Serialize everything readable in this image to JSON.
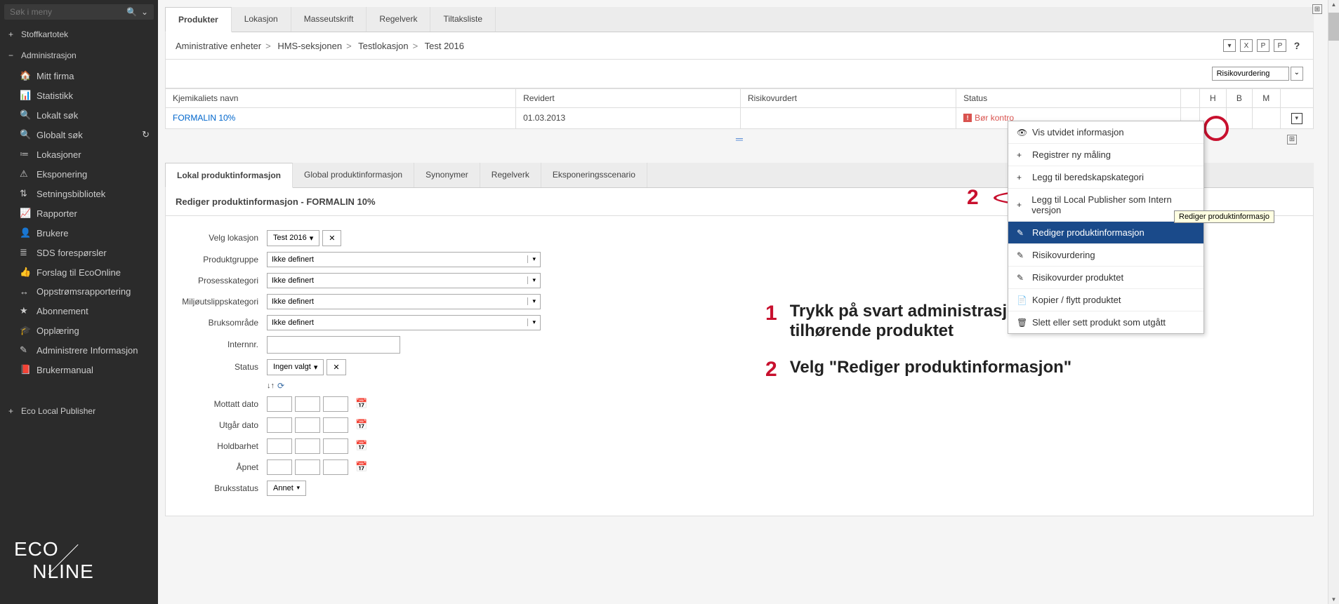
{
  "sidebar": {
    "search_placeholder": "Søk i meny",
    "sections": [
      {
        "toggle": "+",
        "label": "Stoffkartotek"
      },
      {
        "toggle": "−",
        "label": "Administrasjon"
      }
    ],
    "items": [
      {
        "icon": "🏠",
        "label": "Mitt firma"
      },
      {
        "icon": "📊",
        "label": "Statistikk"
      },
      {
        "icon": "🔍",
        "label": "Lokalt søk"
      },
      {
        "icon": "🔍",
        "label": "Globalt søk",
        "refresh": true
      },
      {
        "icon": "≔",
        "label": "Lokasjoner"
      },
      {
        "icon": "⚠",
        "label": "Eksponering"
      },
      {
        "icon": "⇅",
        "label": "Setningsbibliotek"
      },
      {
        "icon": "📈",
        "label": "Rapporter"
      },
      {
        "icon": "👤",
        "label": "Brukere"
      },
      {
        "icon": "≣",
        "label": "SDS forespørsler"
      },
      {
        "icon": "👍",
        "label": "Forslag til EcoOnline"
      },
      {
        "icon": "↔",
        "label": "Oppstrømsrapportering"
      },
      {
        "icon": "★",
        "label": "Abonnement"
      },
      {
        "icon": "🎓",
        "label": "Opplæring"
      },
      {
        "icon": "✎",
        "label": "Administrere Informasjon"
      },
      {
        "icon": "📕",
        "label": "Brukermanual"
      }
    ],
    "bottom_section": {
      "toggle": "+",
      "label": "Eco Local Publisher"
    },
    "logo_top": "ECO",
    "logo_bottom": "NLINE"
  },
  "tabs": [
    "Produkter",
    "Lokasjon",
    "Masseutskrift",
    "Regelverk",
    "Tiltaksliste"
  ],
  "breadcrumb": [
    "Aministrative enheter",
    "HMS-seksjonen",
    "Testlokasjon",
    "Test 2016"
  ],
  "help_label": "?",
  "filter_select": "Risikovurdering",
  "table": {
    "headers": [
      "Kjemikaliets navn",
      "Revidert",
      "Risikovurdert",
      "Status",
      "",
      "H",
      "B",
      "M",
      ""
    ],
    "row": {
      "name": "FORMALIN 10%",
      "revidert": "01.03.2013",
      "risiko": "",
      "status": "Bør kontro"
    }
  },
  "sub_tabs": [
    "Lokal produktinformasjon",
    "Global produktinformasjon",
    "Synonymer",
    "Regelverk",
    "Eksponeringsscenario"
  ],
  "edit_header": "Rediger produktinformasjon - FORMALIN 10%",
  "form": {
    "velg_lokasjon_label": "Velg lokasjon",
    "velg_lokasjon_value": "Test 2016",
    "produktgruppe_label": "Produktgruppe",
    "produktgruppe_value": "Ikke definert",
    "prosesskategori_label": "Prosesskategori",
    "prosesskategori_value": "Ikke definert",
    "miljo_label": "Miljøutslippskategori",
    "miljo_value": "Ikke definert",
    "bruksomrade_label": "Bruksområde",
    "bruksomrade_value": "Ikke definert",
    "internnr_label": "Internnr.",
    "status_label": "Status",
    "status_value": "Ingen valgt",
    "mottatt_label": "Mottatt dato",
    "utgar_label": "Utgår dato",
    "holdbarhet_label": "Holdbarhet",
    "apnet_label": "Åpnet",
    "bruksstatus_label": "Bruksstatus",
    "bruksstatus_value": "Annet"
  },
  "context_menu": [
    {
      "icon": "👁",
      "label": "Vis utvidet informasjon"
    },
    {
      "icon": "+",
      "label": "Registrer ny måling"
    },
    {
      "icon": "+",
      "label": "Legg til beredskapskategori"
    },
    {
      "icon": "+",
      "label": "Legg til Local Publisher som Intern versjon"
    },
    {
      "icon": "✎",
      "label": "Rediger produktinformasjon",
      "highlighted": true
    },
    {
      "icon": "✎",
      "label": "Risikovurdering"
    },
    {
      "icon": "✎",
      "label": "Risikovurder produktet"
    },
    {
      "icon": "📄",
      "label": "Kopier / flytt produktet"
    },
    {
      "icon": "🗑",
      "label": "Slett eller sett produkt som utgått"
    }
  ],
  "tooltip_text": "Rediger produktinformasjo",
  "annotations": {
    "num1": "1",
    "text1a": "Trykk på svart administrasjons-pil,",
    "text1b": "tilhørende produktet",
    "num2": "2",
    "text2": "Velg \"Rediger produktinformasjon\""
  }
}
